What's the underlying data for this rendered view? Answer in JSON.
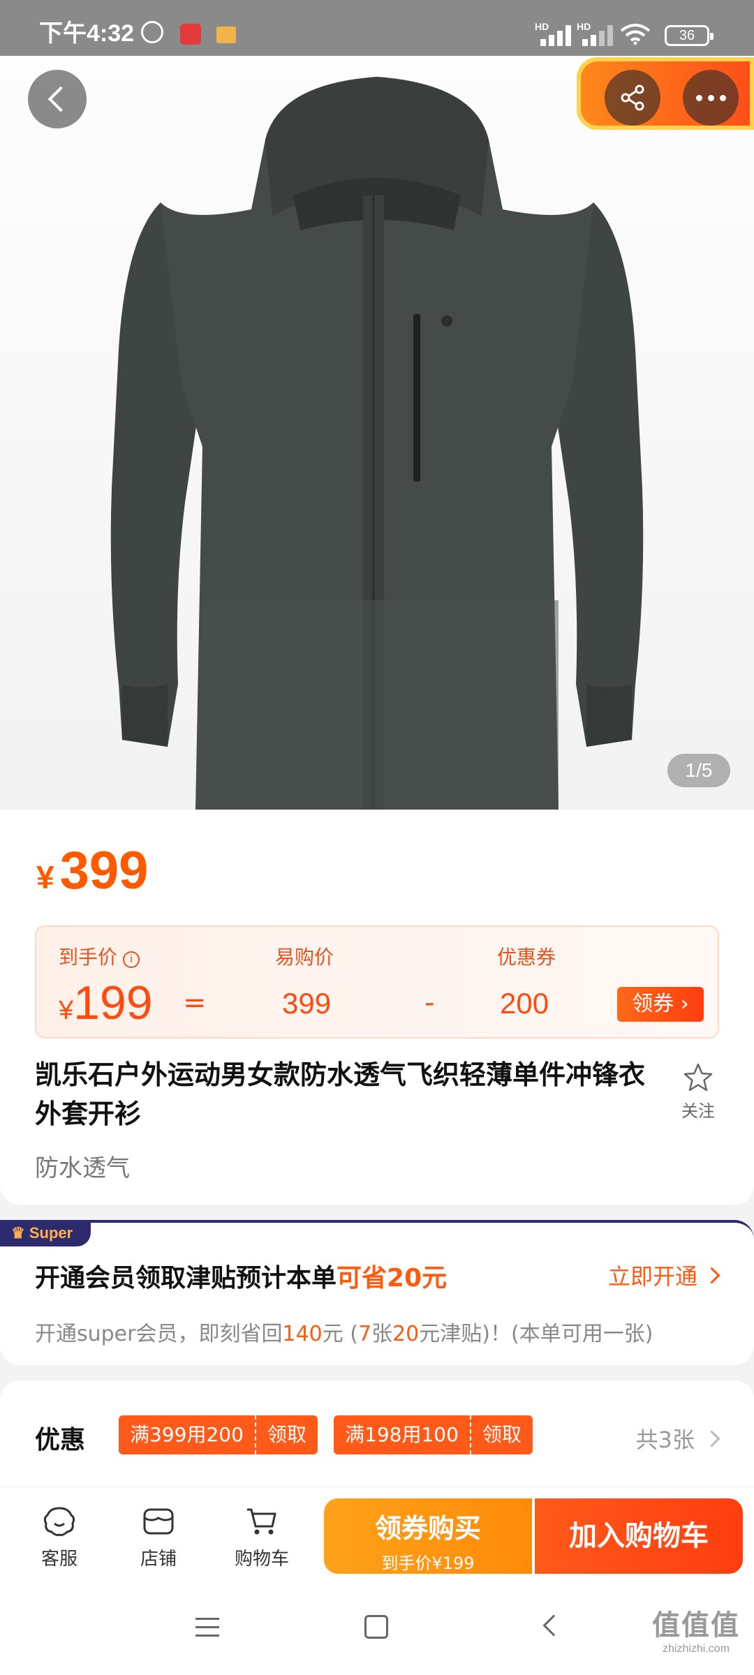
{
  "status_bar": {
    "time": "下午4:32",
    "hd1": "HD",
    "hd2": "HD",
    "battery": "36"
  },
  "hero": {
    "page_indicator": "1/5"
  },
  "price": {
    "currency": "¥",
    "main": "399",
    "final_label": "到手价",
    "final_value": "199",
    "equals": "=",
    "yigou_label": "易购价",
    "yigou_value": "399",
    "minus": "-",
    "coupon_label": "优惠券",
    "coupon_value": "200",
    "coupon_button": "领券"
  },
  "product": {
    "title": "凯乐石户外运动男女款防水透气飞织轻薄单件冲锋衣外套开衫",
    "subtitle": "防水透气",
    "follow_label": "关注"
  },
  "super": {
    "tag": "Super",
    "title_prefix": "开通会员领取津贴预计本单",
    "title_highlight": "可省20元",
    "link": "立即开通",
    "desc_1": "开通super会员，即刻省回",
    "desc_2": "140",
    "desc_3": "元 (",
    "desc_4": "7",
    "desc_5": "张",
    "desc_6": "20",
    "desc_7": "元津贴)！(本单可用一张)"
  },
  "discounts": {
    "label": "优惠",
    "chips": [
      {
        "text": "满399用200",
        "action": "领取"
      },
      {
        "text": "满198用100",
        "action": "领取"
      }
    ],
    "count": "共3张"
  },
  "bottom_bar": {
    "service": "客服",
    "store": "店铺",
    "cart": "购物车",
    "buy_title": "领券购买",
    "buy_sub": "到手价¥199",
    "add_cart": "加入购物车"
  },
  "watermark": {
    "line1": "值值值",
    "line2": "zhizhizhi.com"
  },
  "colors": {
    "accent": "#ff5a10",
    "price": "#ff5a00",
    "super_bg": "#2d2a6e"
  }
}
